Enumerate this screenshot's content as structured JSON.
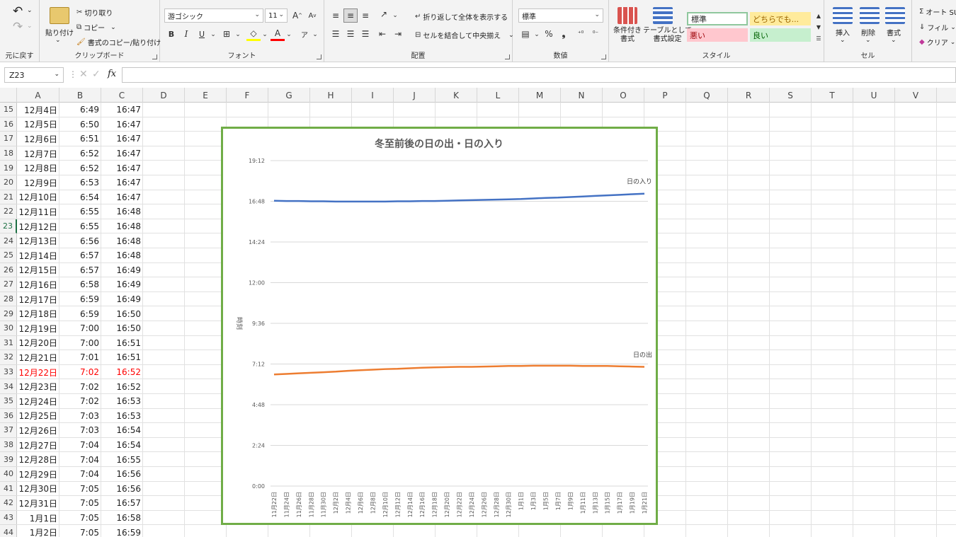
{
  "ribbon": {
    "undo": {
      "label": "元に戻す"
    },
    "clipboard": {
      "paste": "貼り付け",
      "cut": "切り取り",
      "copy": "コピー",
      "format_painter": "書式のコピー/貼り付け",
      "label": "クリップボード"
    },
    "font": {
      "name": "游ゴシック",
      "size": "11",
      "bold": "B",
      "italic": "I",
      "underline": "U",
      "font_color_glyph": "A",
      "label": "フォント"
    },
    "alignment": {
      "wrap": "折り返して全体を表示する",
      "merge": "セルを結合して中央揃え",
      "label": "配置"
    },
    "number": {
      "format": "標準",
      "percent": "%",
      "comma": "❟",
      "label": "数値"
    },
    "styles": {
      "conditional": "条件付き\n書式",
      "table": "テーブルとして\n書式設定",
      "normal": "標準",
      "neutral": "どちらでも...",
      "bad": "悪い",
      "good": "良い",
      "label": "スタイル"
    },
    "cells": {
      "insert": "挿入",
      "delete": "削除",
      "format": "書式",
      "label": "セル"
    },
    "editing": {
      "autosum": "オート SU",
      "fill": "フィル",
      "clear": "クリア"
    }
  },
  "formula_bar": {
    "name_box": "Z23",
    "fx": "fx",
    "value": ""
  },
  "columns": [
    "A",
    "B",
    "C",
    "D",
    "E",
    "F",
    "G",
    "H",
    "I",
    "J",
    "K",
    "L",
    "M",
    "N",
    "O",
    "P",
    "Q",
    "R",
    "S",
    "T",
    "U",
    "V"
  ],
  "rows": [
    {
      "num": "15",
      "a": "12月4日",
      "b": "6:49",
      "c": "16:47"
    },
    {
      "num": "16",
      "a": "12月5日",
      "b": "6:50",
      "c": "16:47"
    },
    {
      "num": "17",
      "a": "12月6日",
      "b": "6:51",
      "c": "16:47"
    },
    {
      "num": "18",
      "a": "12月7日",
      "b": "6:52",
      "c": "16:47"
    },
    {
      "num": "19",
      "a": "12月8日",
      "b": "6:52",
      "c": "16:47"
    },
    {
      "num": "20",
      "a": "12月9日",
      "b": "6:53",
      "c": "16:47"
    },
    {
      "num": "21",
      "a": "12月10日",
      "b": "6:54",
      "c": "16:47"
    },
    {
      "num": "22",
      "a": "12月11日",
      "b": "6:55",
      "c": "16:48"
    },
    {
      "num": "23",
      "a": "12月12日",
      "b": "6:55",
      "c": "16:48"
    },
    {
      "num": "24",
      "a": "12月13日",
      "b": "6:56",
      "c": "16:48"
    },
    {
      "num": "25",
      "a": "12月14日",
      "b": "6:57",
      "c": "16:48"
    },
    {
      "num": "26",
      "a": "12月15日",
      "b": "6:57",
      "c": "16:49"
    },
    {
      "num": "27",
      "a": "12月16日",
      "b": "6:58",
      "c": "16:49"
    },
    {
      "num": "28",
      "a": "12月17日",
      "b": "6:59",
      "c": "16:49"
    },
    {
      "num": "29",
      "a": "12月18日",
      "b": "6:59",
      "c": "16:50"
    },
    {
      "num": "30",
      "a": "12月19日",
      "b": "7:00",
      "c": "16:50"
    },
    {
      "num": "31",
      "a": "12月20日",
      "b": "7:00",
      "c": "16:51"
    },
    {
      "num": "32",
      "a": "12月21日",
      "b": "7:01",
      "c": "16:51"
    },
    {
      "num": "33",
      "a": "12月22日",
      "b": "7:02",
      "c": "16:52",
      "highlight": true
    },
    {
      "num": "34",
      "a": "12月23日",
      "b": "7:02",
      "c": "16:52"
    },
    {
      "num": "35",
      "a": "12月24日",
      "b": "7:02",
      "c": "16:53"
    },
    {
      "num": "36",
      "a": "12月25日",
      "b": "7:03",
      "c": "16:53"
    },
    {
      "num": "37",
      "a": "12月26日",
      "b": "7:03",
      "c": "16:54"
    },
    {
      "num": "38",
      "a": "12月27日",
      "b": "7:04",
      "c": "16:54"
    },
    {
      "num": "39",
      "a": "12月28日",
      "b": "7:04",
      "c": "16:55"
    },
    {
      "num": "40",
      "a": "12月29日",
      "b": "7:04",
      "c": "16:56"
    },
    {
      "num": "41",
      "a": "12月30日",
      "b": "7:05",
      "c": "16:56"
    },
    {
      "num": "42",
      "a": "12月31日",
      "b": "7:05",
      "c": "16:57"
    },
    {
      "num": "43",
      "a": "1月1日",
      "b": "7:05",
      "c": "16:58"
    },
    {
      "num": "44",
      "a": "1月2日",
      "b": "7:05",
      "c": "16:59"
    }
  ],
  "colors": {
    "highlight": "#ff0000",
    "sunset": "#4472c4",
    "sunrise": "#ed7d31",
    "chart_border": "#70ad47",
    "grid": "#d9d9d9",
    "excel_green": "#1e7145"
  },
  "chart_data": {
    "type": "line",
    "title": "冬至前後の日の出・日の入り",
    "ylabel": "時刻",
    "ylim": [
      "0:00",
      "19:12"
    ],
    "y_ticks": [
      "0:00",
      "2:24",
      "4:48",
      "7:12",
      "9:36",
      "12:00",
      "14:24",
      "16:48",
      "19:12"
    ],
    "x_ticks": [
      "11月22日",
      "11月24日",
      "11月26日",
      "11月28日",
      "11月30日",
      "12月2日",
      "12月4日",
      "12月6日",
      "12月8日",
      "12月10日",
      "12月12日",
      "12月14日",
      "12月16日",
      "12月18日",
      "12月20日",
      "12月22日",
      "12月24日",
      "12月26日",
      "12月28日",
      "12月30日",
      "1月1日",
      "1月3日",
      "1月5日",
      "1月7日",
      "1月9日",
      "1月11日",
      "1月13日",
      "1月15日",
      "1月17日",
      "1月19日",
      "1月21日"
    ],
    "x_range": [
      "11月22日",
      "1月22日"
    ],
    "series": [
      {
        "name": "日の入り",
        "color": "#4472c4",
        "values": [
          "16:50",
          "16:49",
          "16:49",
          "16:48",
          "16:48",
          "16:47",
          "16:47",
          "16:47",
          "16:47",
          "16:47",
          "16:48",
          "16:48",
          "16:49",
          "16:49",
          "16:50",
          "16:51",
          "16:52",
          "16:53",
          "16:54",
          "16:55",
          "16:56",
          "16:58",
          "17:00",
          "17:01",
          "17:03",
          "17:05",
          "17:07",
          "17:09",
          "17:11",
          "17:13",
          "17:15"
        ]
      },
      {
        "name": "日の出",
        "color": "#ed7d31",
        "values": [
          "6:35",
          "6:37",
          "6:39",
          "6:41",
          "6:43",
          "6:45",
          "6:48",
          "6:50",
          "6:52",
          "6:54",
          "6:55",
          "6:57",
          "6:59",
          "7:00",
          "7:01",
          "7:02",
          "7:02",
          "7:03",
          "7:04",
          "7:05",
          "7:05",
          "7:06",
          "7:06",
          "7:06",
          "7:06",
          "7:05",
          "7:05",
          "7:05",
          "7:04",
          "7:03",
          "7:02"
        ]
      }
    ]
  }
}
